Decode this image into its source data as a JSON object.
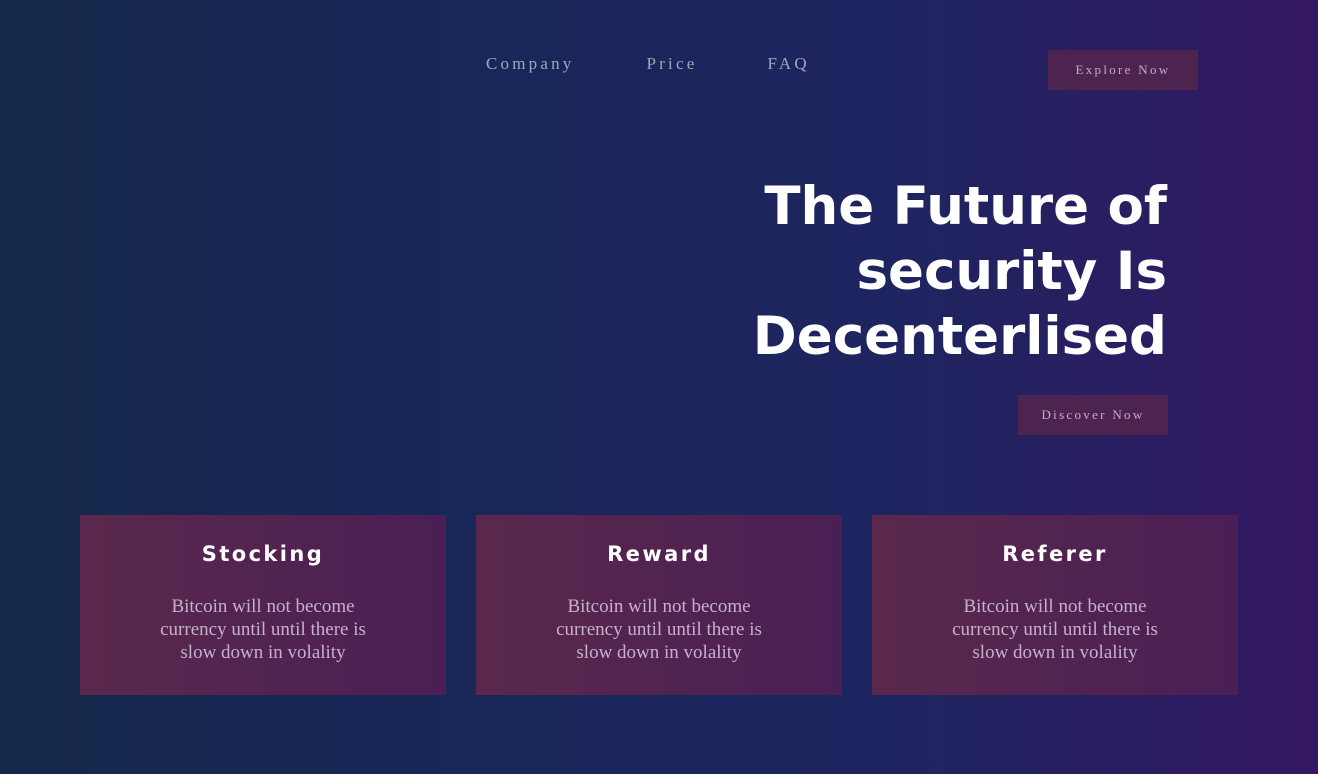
{
  "nav": {
    "links": [
      "Company",
      "Price",
      "FAQ"
    ],
    "cta_label": "Explore Now"
  },
  "hero": {
    "title": "The Future of security Is Decenterlised",
    "cta_label": "Discover Now"
  },
  "cards": [
    {
      "title": "Stocking",
      "text": "Bitcoin will not become currency until until there is slow down in volality"
    },
    {
      "title": "Reward",
      "text": "Bitcoin will not become currency until until there is slow down in volality"
    },
    {
      "title": "Referer",
      "text": "Bitcoin will not become currency until until there is slow down in volality"
    }
  ],
  "colors": {
    "background_start": "#14284a",
    "background_end": "#341862",
    "button_bg": "#4d2450",
    "card_bg": "#5a284c",
    "nav_text": "#a3a6b8"
  }
}
